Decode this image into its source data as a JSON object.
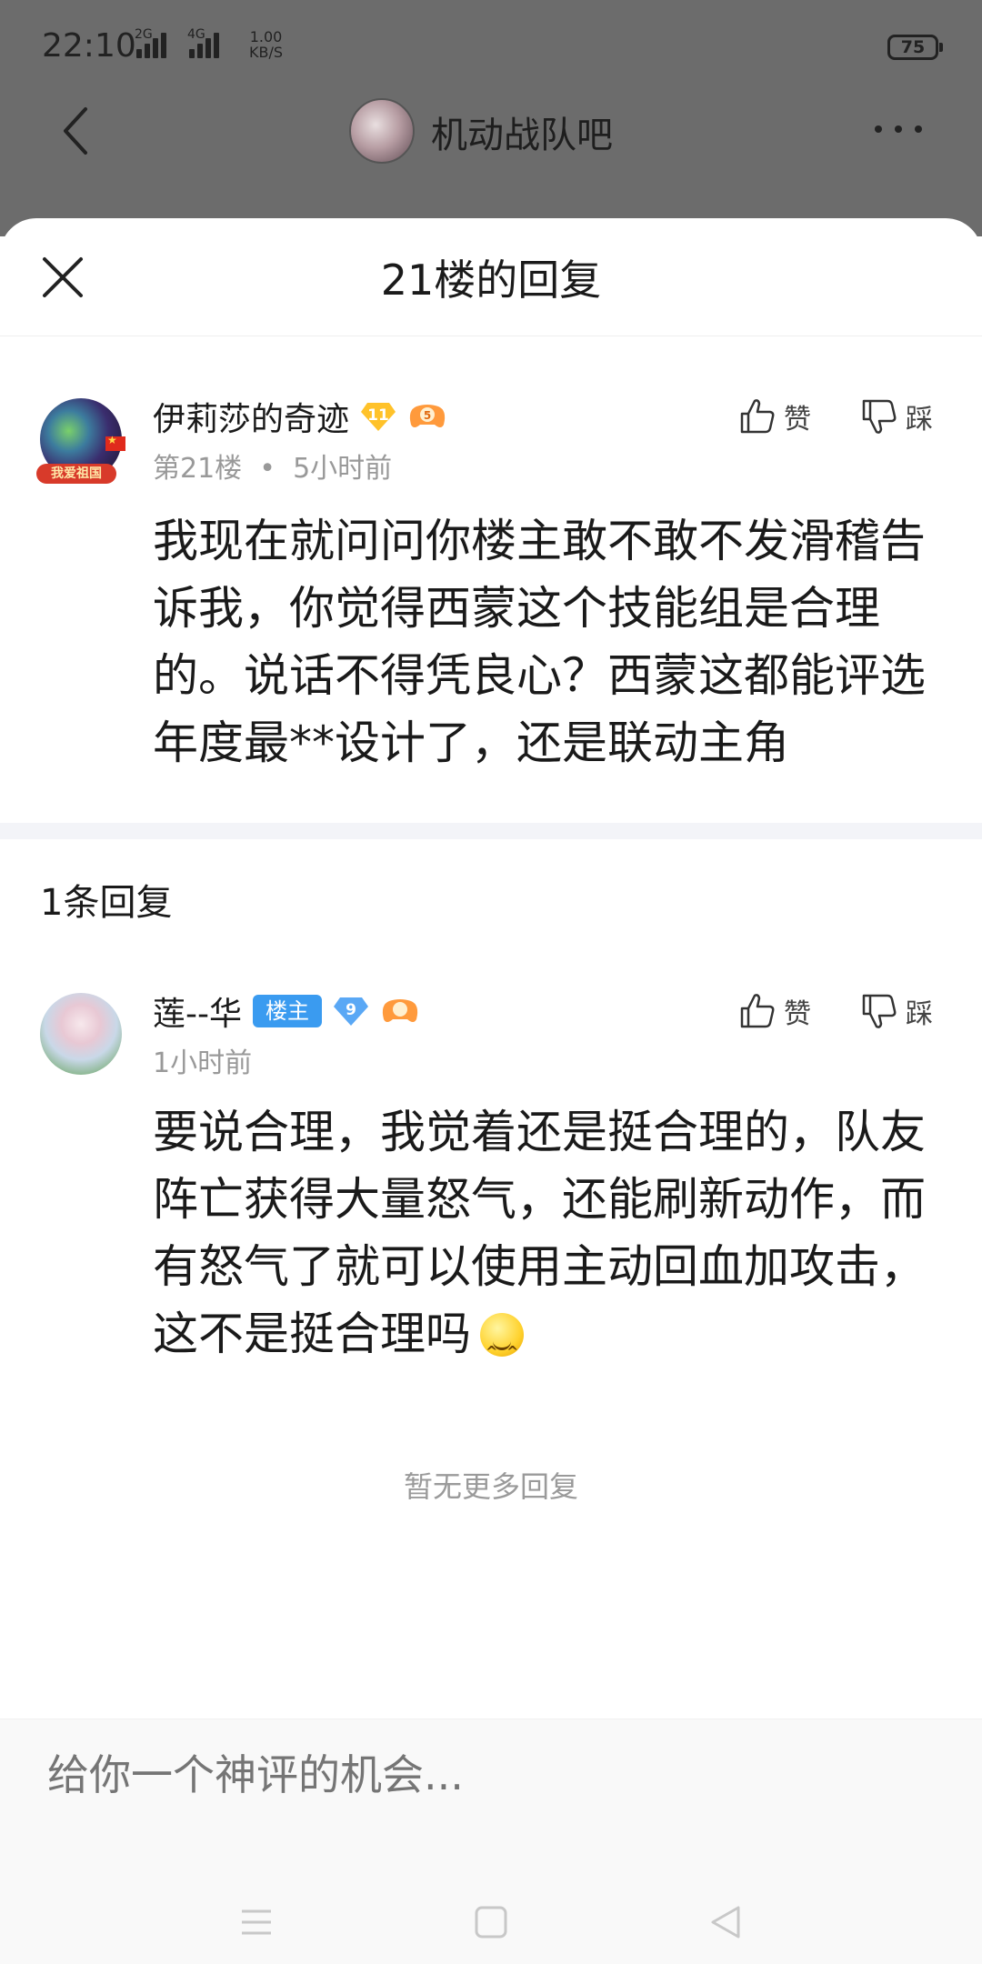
{
  "status_bar": {
    "time": "22:10",
    "signal1_label": "2G",
    "signal2_label": "4G",
    "net_speed_value": "1.00",
    "net_speed_unit": "KB/S",
    "battery": "75"
  },
  "app_bar": {
    "forum_title": "机动战队吧"
  },
  "sheet": {
    "title": "21楼的回复"
  },
  "main_post": {
    "username": "伊莉莎的奇迹",
    "level": "11",
    "game_level": "5",
    "avatar_badge": "我爱祖国",
    "floor": "第21楼",
    "time": "5小时前",
    "like_label": "赞",
    "dislike_label": "踩",
    "content": "我现在就问问你楼主敢不敢不发滑稽告诉我，你觉得西蒙这个技能组是合理的。说话不得凭良心？西蒙这都能评选年度最**设计了，还是联动主角"
  },
  "replies": {
    "count_label": "1条回复",
    "items": [
      {
        "username": "莲--华",
        "owner_tag": "楼主",
        "level": "9",
        "time": "1小时前",
        "like_label": "赞",
        "dislike_label": "踩",
        "content": "要说合理，我觉着还是挺合理的，队友阵亡获得大量怒气，还能刷新动作，而有怒气了就可以使用主动回血加攻击，这不是挺合理吗"
      }
    ],
    "no_more_label": "暂无更多回复"
  },
  "comment_box": {
    "placeholder": "给你一个神评的机会..."
  },
  "colors": {
    "owner_tag_bg": "#3a9bf0",
    "dim_overlay": "#6c6c6c",
    "meta_text": "#999999"
  },
  "icons": [
    "back-icon",
    "more-icon",
    "close-icon",
    "thumb-up-icon",
    "thumb-down-icon",
    "diamond-level-icon",
    "game-controller-icon",
    "emoji-icon",
    "menu-nav-icon",
    "home-nav-icon",
    "back-nav-icon"
  ]
}
